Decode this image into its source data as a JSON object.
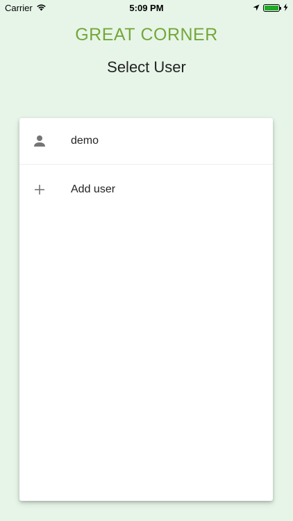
{
  "status_bar": {
    "carrier": "Carrier",
    "time": "5:09 PM",
    "icons": [
      "wifi-icon",
      "location-arrow-icon",
      "battery-icon",
      "charging-icon"
    ]
  },
  "header": {
    "logo_text_1": "GREAT",
    "logo_text_2": "CORNER",
    "title": "Select User"
  },
  "user_list": {
    "items": [
      {
        "label": "demo",
        "icon": "person-icon"
      },
      {
        "label": "Add user",
        "icon": "plus-icon"
      }
    ]
  },
  "colors": {
    "background": "#e7f5e8",
    "logo_green": "#74a73a",
    "logo_orange": "#e07c1e",
    "battery_green": "#1faa27"
  }
}
